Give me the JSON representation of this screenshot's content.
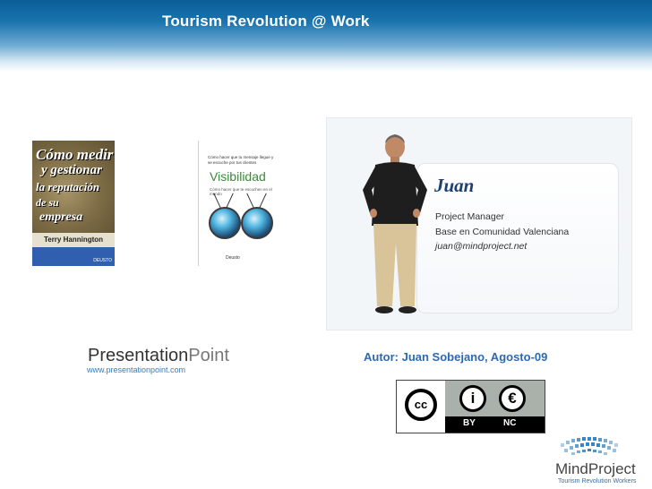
{
  "header": {
    "title": "Tourism Revolution @ Work"
  },
  "book1": {
    "title_lines": [
      "Cómo medir",
      "y gestionar",
      "la reputación",
      "de su",
      "empresa"
    ],
    "author": "Terry Hannington",
    "publisher": "DEUSTO"
  },
  "book2": {
    "top_text": "Cómo hacer que tu mensaje llegue y se escuche por tus clientes",
    "title": "Visibilidad",
    "subtitle": "Cómo hacer que te escuchen en el mundo",
    "publisher": "Deusto"
  },
  "profile": {
    "name": "Juan",
    "role": "Project Manager",
    "base": "Base en Comunidad Valenciana",
    "email": "juan@mindproject.net"
  },
  "presentation_point": {
    "word1": "Presentation",
    "word2": "Point",
    "url": "www.presentationpoint.com"
  },
  "author_line": "Autor: Juan Sobejano, Agosto-09",
  "license": {
    "cc": "cc",
    "by": "BY",
    "nc": "NC",
    "by_symbol": "i",
    "nc_symbol": "€"
  },
  "mindproject": {
    "name": "MindProject",
    "tagline": "Tourism Revolution Workers"
  }
}
